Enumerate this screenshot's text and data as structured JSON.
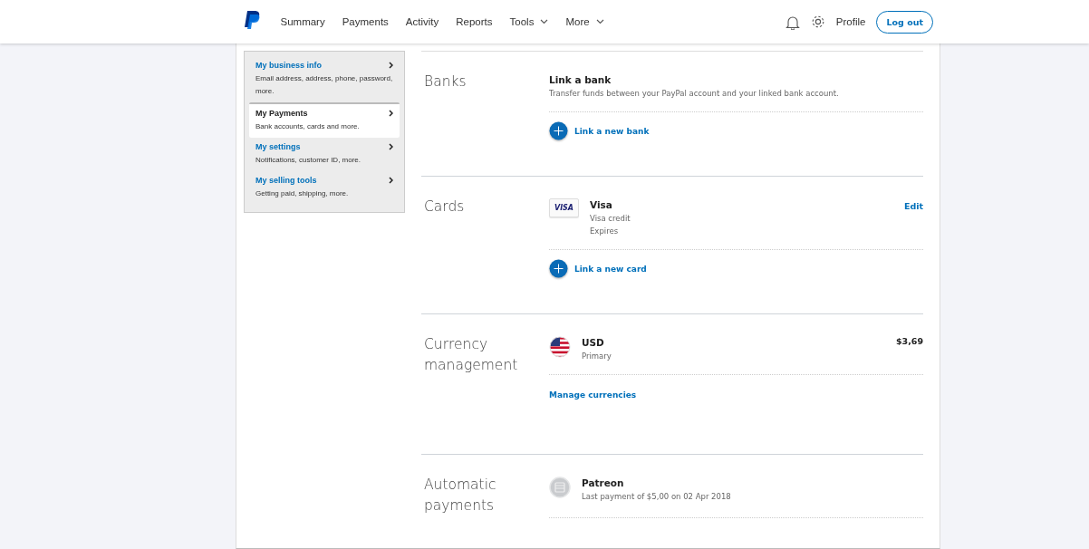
{
  "nav": {
    "items": [
      {
        "label": "Summary",
        "kind": "link"
      },
      {
        "label": "Payments",
        "kind": "link"
      },
      {
        "label": "Activity",
        "kind": "link"
      },
      {
        "label": "Reports",
        "kind": "link"
      },
      {
        "label": "Tools",
        "kind": "menu"
      },
      {
        "label": "More",
        "kind": "menu"
      }
    ],
    "profile": "Profile",
    "logout": "Log out"
  },
  "sidebar": {
    "items": [
      {
        "title": "My business info",
        "description": "Email address, address, phone, password, more.",
        "selected": false
      },
      {
        "title": "My Payments",
        "description": "Bank accounts, cards and more.",
        "selected": true
      },
      {
        "title": "My settings",
        "description": "Notifications, customer ID, more.",
        "selected": false
      },
      {
        "title": "My selling tools",
        "description": "Getting paid, shipping, more.",
        "selected": false
      }
    ]
  },
  "sections": [
    {
      "title": "Banks",
      "entries": [
        {
          "kind": "text",
          "name": "Link a bank",
          "lines": [
            "Transfer funds between your PayPal account and your linked bank account."
          ]
        }
      ],
      "action": {
        "kind": "add",
        "label": "Link a new bank"
      }
    },
    {
      "title": "Cards",
      "entries": [
        {
          "kind": "card",
          "badge": "VISA",
          "name": "Visa",
          "lines": [
            "Visa credit",
            "Expires"
          ],
          "edit": "Edit"
        }
      ],
      "action": {
        "kind": "add",
        "label": "Link a new card"
      }
    },
    {
      "title": "Currency management",
      "entries": [
        {
          "kind": "currency",
          "name": "USD",
          "lines": [
            "Primary"
          ],
          "amount": "$3,69"
        }
      ],
      "action": {
        "kind": "link",
        "label": "Manage currencies"
      }
    },
    {
      "title": "Automatic payments",
      "entries": [
        {
          "kind": "merchant",
          "name": "Patreon",
          "lines": [
            "Last payment of $5,00 on 02 Apr 2018"
          ]
        }
      ]
    }
  ]
}
